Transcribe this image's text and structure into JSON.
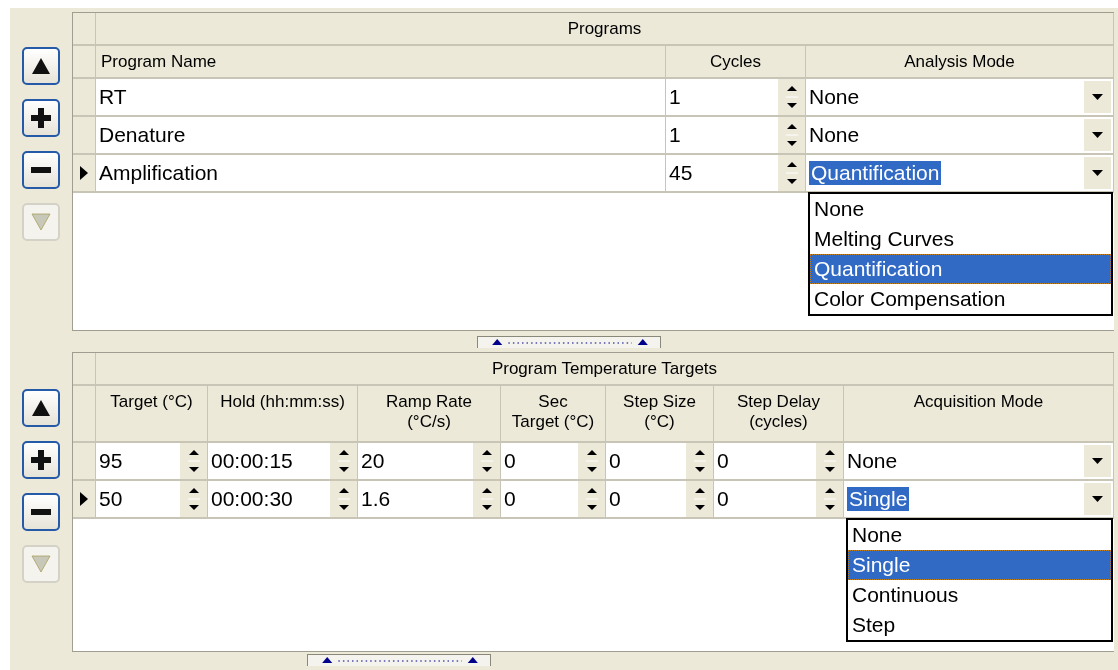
{
  "sections": [
    {
      "title": "Programs",
      "toolbar": [
        {
          "kind": "move_up",
          "disabled": false
        },
        {
          "kind": "add",
          "disabled": false
        },
        {
          "kind": "remove",
          "disabled": false
        },
        {
          "kind": "move_down",
          "disabled": true
        }
      ],
      "columns": [
        {
          "label": "Program Name",
          "kind": "text"
        },
        {
          "label": "Cycles",
          "kind": "spin"
        },
        {
          "label": "Analysis Mode",
          "kind": "combo"
        }
      ],
      "rows": [
        {
          "cells": [
            "RT",
            "1",
            "None"
          ],
          "current": false
        },
        {
          "cells": [
            "Denature",
            "1",
            "None"
          ],
          "current": false
        },
        {
          "cells": [
            "Amplification",
            "45",
            "Quantification"
          ],
          "current": true
        }
      ],
      "dropdown": {
        "options": [
          {
            "label": "None",
            "selected": false
          },
          {
            "label": "Melting Curves",
            "selected": false
          },
          {
            "label": "Quantification",
            "selected": true
          },
          {
            "label": "Color Compensation",
            "selected": false
          }
        ]
      }
    },
    {
      "title": "Program Temperature Targets",
      "toolbar": [
        {
          "kind": "move_up",
          "disabled": false
        },
        {
          "kind": "add",
          "disabled": false
        },
        {
          "kind": "remove",
          "disabled": false
        },
        {
          "kind": "move_down",
          "disabled": true
        }
      ],
      "columns": [
        {
          "label": "Target (°C)",
          "kind": "spin"
        },
        {
          "label": "Hold (hh:mm:ss)",
          "kind": "spin"
        },
        {
          "label": "Ramp Rate\n(°C/s)",
          "kind": "spin"
        },
        {
          "label": "Sec\nTarget (°C)",
          "kind": "spin"
        },
        {
          "label": "Step Size\n(°C)",
          "kind": "spin"
        },
        {
          "label": "Step Delay\n(cycles)",
          "kind": "spin"
        },
        {
          "label": "Acquisition Mode",
          "kind": "combo"
        }
      ],
      "rows": [
        {
          "cells": [
            "95",
            "00:00:15",
            "20",
            "0",
            "0",
            "0",
            "None"
          ],
          "current": false
        },
        {
          "cells": [
            "50",
            "00:00:30",
            "1.6",
            "0",
            "0",
            "0",
            "Single"
          ],
          "current": true
        }
      ],
      "dropdown": {
        "options": [
          {
            "label": "None",
            "selected": false
          },
          {
            "label": "Single",
            "selected": true
          },
          {
            "label": "Continuous",
            "selected": false
          },
          {
            "label": "Step",
            "selected": false
          }
        ]
      }
    }
  ]
}
